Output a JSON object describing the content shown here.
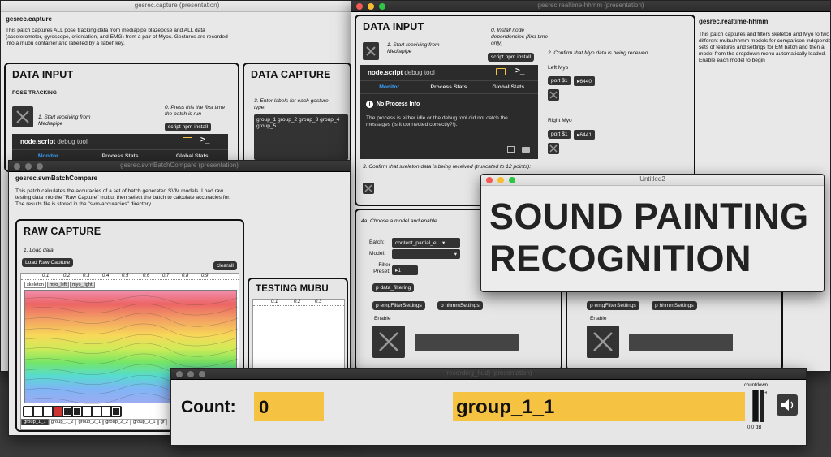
{
  "colors": {
    "accent": "#f5c242",
    "monitor": "#3aa3ff",
    "panel": "#e6e6e6",
    "dark": "#2b2b2b"
  },
  "capture": {
    "title": "gesrec.capture (presentation)",
    "patch_name": "gesrec.capture",
    "description": "This patch captures ALL pose tracking data from mediapipe blazepose and ALL data (accelerometer, gyroscope, orientation, and EMG) from a pair of Myos. Gestures are recorded into a mubu container and labelled by a 'label' key.",
    "data_input_heading": "DATA INPUT",
    "pose_tracking": "POSE TRACKING",
    "step1": "1. Start receiving from Mediapipe",
    "step0": "0. Press this the first time the patch is run",
    "npm_button": "script npm install",
    "data_capture_heading": "DATA CAPTURE",
    "step3": "3. Enter labels for each gesture type.",
    "labels_text": "group_1 group_2 group_3 group_4 group_5",
    "debug_title": "node.script",
    "debug_sub": "debug tool",
    "tab_monitor": "Monitor",
    "tab_process": "Process Stats",
    "tab_global": "Global Stats"
  },
  "realtime": {
    "title": "gesrec.realtime-hhmm (presentation)",
    "patch_name": "gesrec.realtime-hhmm",
    "description": "This patch captures and filters skeleton and Myo to two different mubu.hhmm models for comparison independent sets of features and settings for EM batch and then a model from the dropdown menu automatically loaded. Enable each model to begin",
    "data_input_heading": "DATA INPUT",
    "step1": "1. Start receiving from Mediapipe",
    "step0": "0. Install node dependencies (first time only)",
    "npm_button": "script npm install",
    "step2": "2. Confirm that Myo data is being received",
    "left_myo": "Left Myo",
    "right_myo": "Right Myo",
    "port_label": "port $1",
    "left_port": "6440",
    "right_port": "6441",
    "debug_title": "node.script",
    "debug_sub": "debug tool",
    "tab_monitor": "Monitor",
    "tab_process": "Process Stats",
    "tab_global": "Global Stats",
    "no_process": "No Process Info",
    "no_process_msg": "The process is either idle or the debug tool did not catch the messages (is it connected correctly?!).",
    "step3": "3. Confirm that skeleton data is being received (truncated to 12 points):",
    "step4a": "4a. Choose a model and enable",
    "batch_label": "Batch:",
    "batch_value": "content_partial_e...",
    "model_label": "Model:",
    "filter_label": "Filter Preset:",
    "filter_value": "1",
    "p_data_filtering": "p data_filtering",
    "p_emg": "p emgFilterSettings",
    "p_hhmm": "p hhmmSettings",
    "enable_label": "Enable",
    "p_emg2": "p emgFilterSettings",
    "p_hhmm2": "p hhmmSettings",
    "enable_label2": "Enable"
  },
  "svm": {
    "title": "gesrec.svmBatchCompare (presentation)",
    "patch_name": "gesrec.svmBatchCompare",
    "description": "This patch calculates the accuracies of a set of batch generated SVM models. Load raw testing data into the \"Raw Capture\" mubu, then select the batch to calculate accuracies for. The results file is stored in the \"svm-accuracies\" directory.",
    "raw_capture_heading": "RAW CAPTURE",
    "load_data": "1. Load data",
    "load_button": "Load Raw Capture",
    "clear_button": "clearall",
    "ruler": [
      "0.1",
      "0.2",
      "0.3",
      "0.4",
      "0.5",
      "0.6",
      "0.7",
      "0.8",
      "0.9"
    ],
    "tabs": [
      "skeleton",
      "myo_left",
      "myo_right"
    ],
    "groups": [
      "group_1_1",
      "group_1_2",
      "group_2_1",
      "group_2_2",
      "group_3_1",
      "gr"
    ],
    "testing_heading": "TESTING MUBU",
    "testing_ruler": [
      "0.1",
      "0.2",
      "0.3"
    ]
  },
  "untitled": {
    "title": "Untitled2",
    "line1": "SOUND PAINTING",
    "line2": "RECOGNITION"
  },
  "hud": {
    "title": "[recording_hud] (presentation)",
    "count_label": "Count:",
    "count_value": "0",
    "label_value": "group_1_1",
    "countdown_label": "countdown",
    "db_label": "0.0 dB"
  }
}
